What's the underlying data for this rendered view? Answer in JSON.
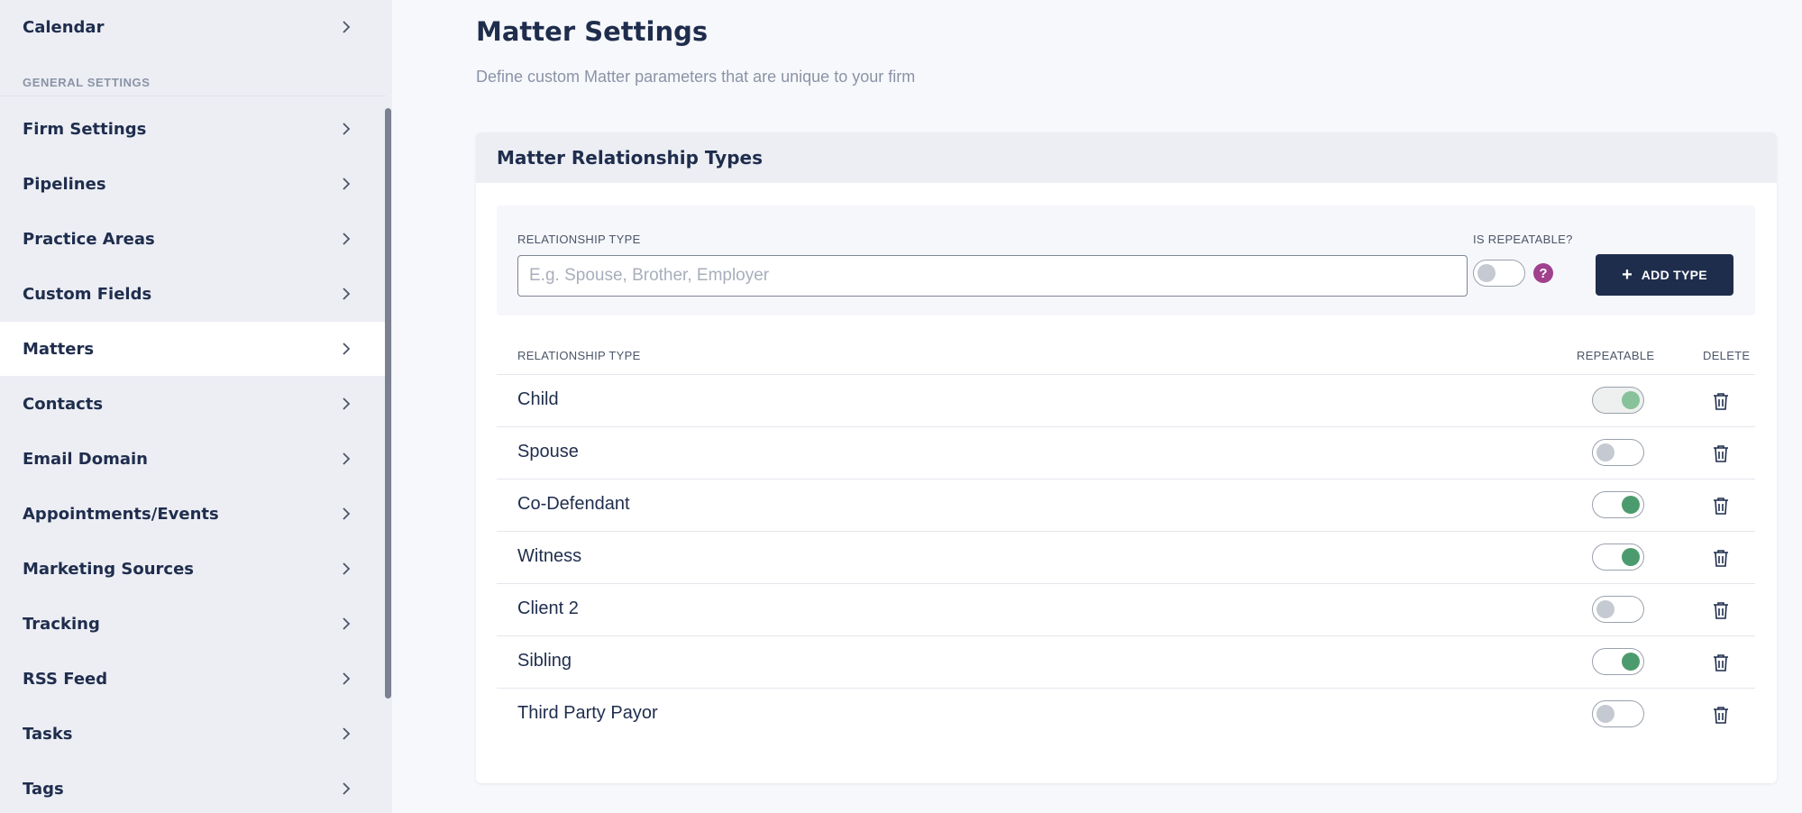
{
  "sidebar": {
    "top_item": {
      "label": "Calendar"
    },
    "section_label": "GENERAL SETTINGS",
    "items": [
      {
        "label": "Firm Settings",
        "active": false
      },
      {
        "label": "Pipelines",
        "active": false
      },
      {
        "label": "Practice Areas",
        "active": false
      },
      {
        "label": "Custom Fields",
        "active": false
      },
      {
        "label": "Matters",
        "active": true
      },
      {
        "label": "Contacts",
        "active": false
      },
      {
        "label": "Email Domain",
        "active": false
      },
      {
        "label": "Appointments/Events",
        "active": false
      },
      {
        "label": "Marketing Sources",
        "active": false
      },
      {
        "label": "Tracking",
        "active": false
      },
      {
        "label": "RSS Feed",
        "active": false
      },
      {
        "label": "Tasks",
        "active": false
      },
      {
        "label": "Tags",
        "active": false
      }
    ],
    "item_icon": "chevron-right-icon"
  },
  "page": {
    "title": "Matter Settings",
    "subtitle": "Define custom Matter parameters that are unique to your firm"
  },
  "card": {
    "title": "Matter Relationship Types",
    "form": {
      "type_label": "RELATIONSHIP TYPE",
      "type_placeholder": "E.g. Spouse, Brother, Employer",
      "type_value": "",
      "repeatable_label": "IS REPEATABLE?",
      "repeatable_on": false,
      "help_glyph": "?",
      "add_button_icon": "+",
      "add_button_label": "ADD TYPE"
    },
    "table": {
      "columns": {
        "type": "RELATIONSHIP TYPE",
        "repeatable": "REPEATABLE",
        "delete": "DELETE"
      },
      "rows": [
        {
          "name": "Child",
          "repeatable": true,
          "dimmed": true
        },
        {
          "name": "Spouse",
          "repeatable": false
        },
        {
          "name": "Co-Defendant",
          "repeatable": true
        },
        {
          "name": "Witness",
          "repeatable": true
        },
        {
          "name": "Client 2",
          "repeatable": false
        },
        {
          "name": "Sibling",
          "repeatable": true
        },
        {
          "name": "Third Party Payor",
          "repeatable": false
        }
      ],
      "delete_icon": "trash-icon"
    }
  },
  "colors": {
    "navy": "#1f2d4d",
    "toggle_on": "#4c9b6e",
    "help": "#a0418d",
    "sidebar_bg": "#eceef4"
  }
}
